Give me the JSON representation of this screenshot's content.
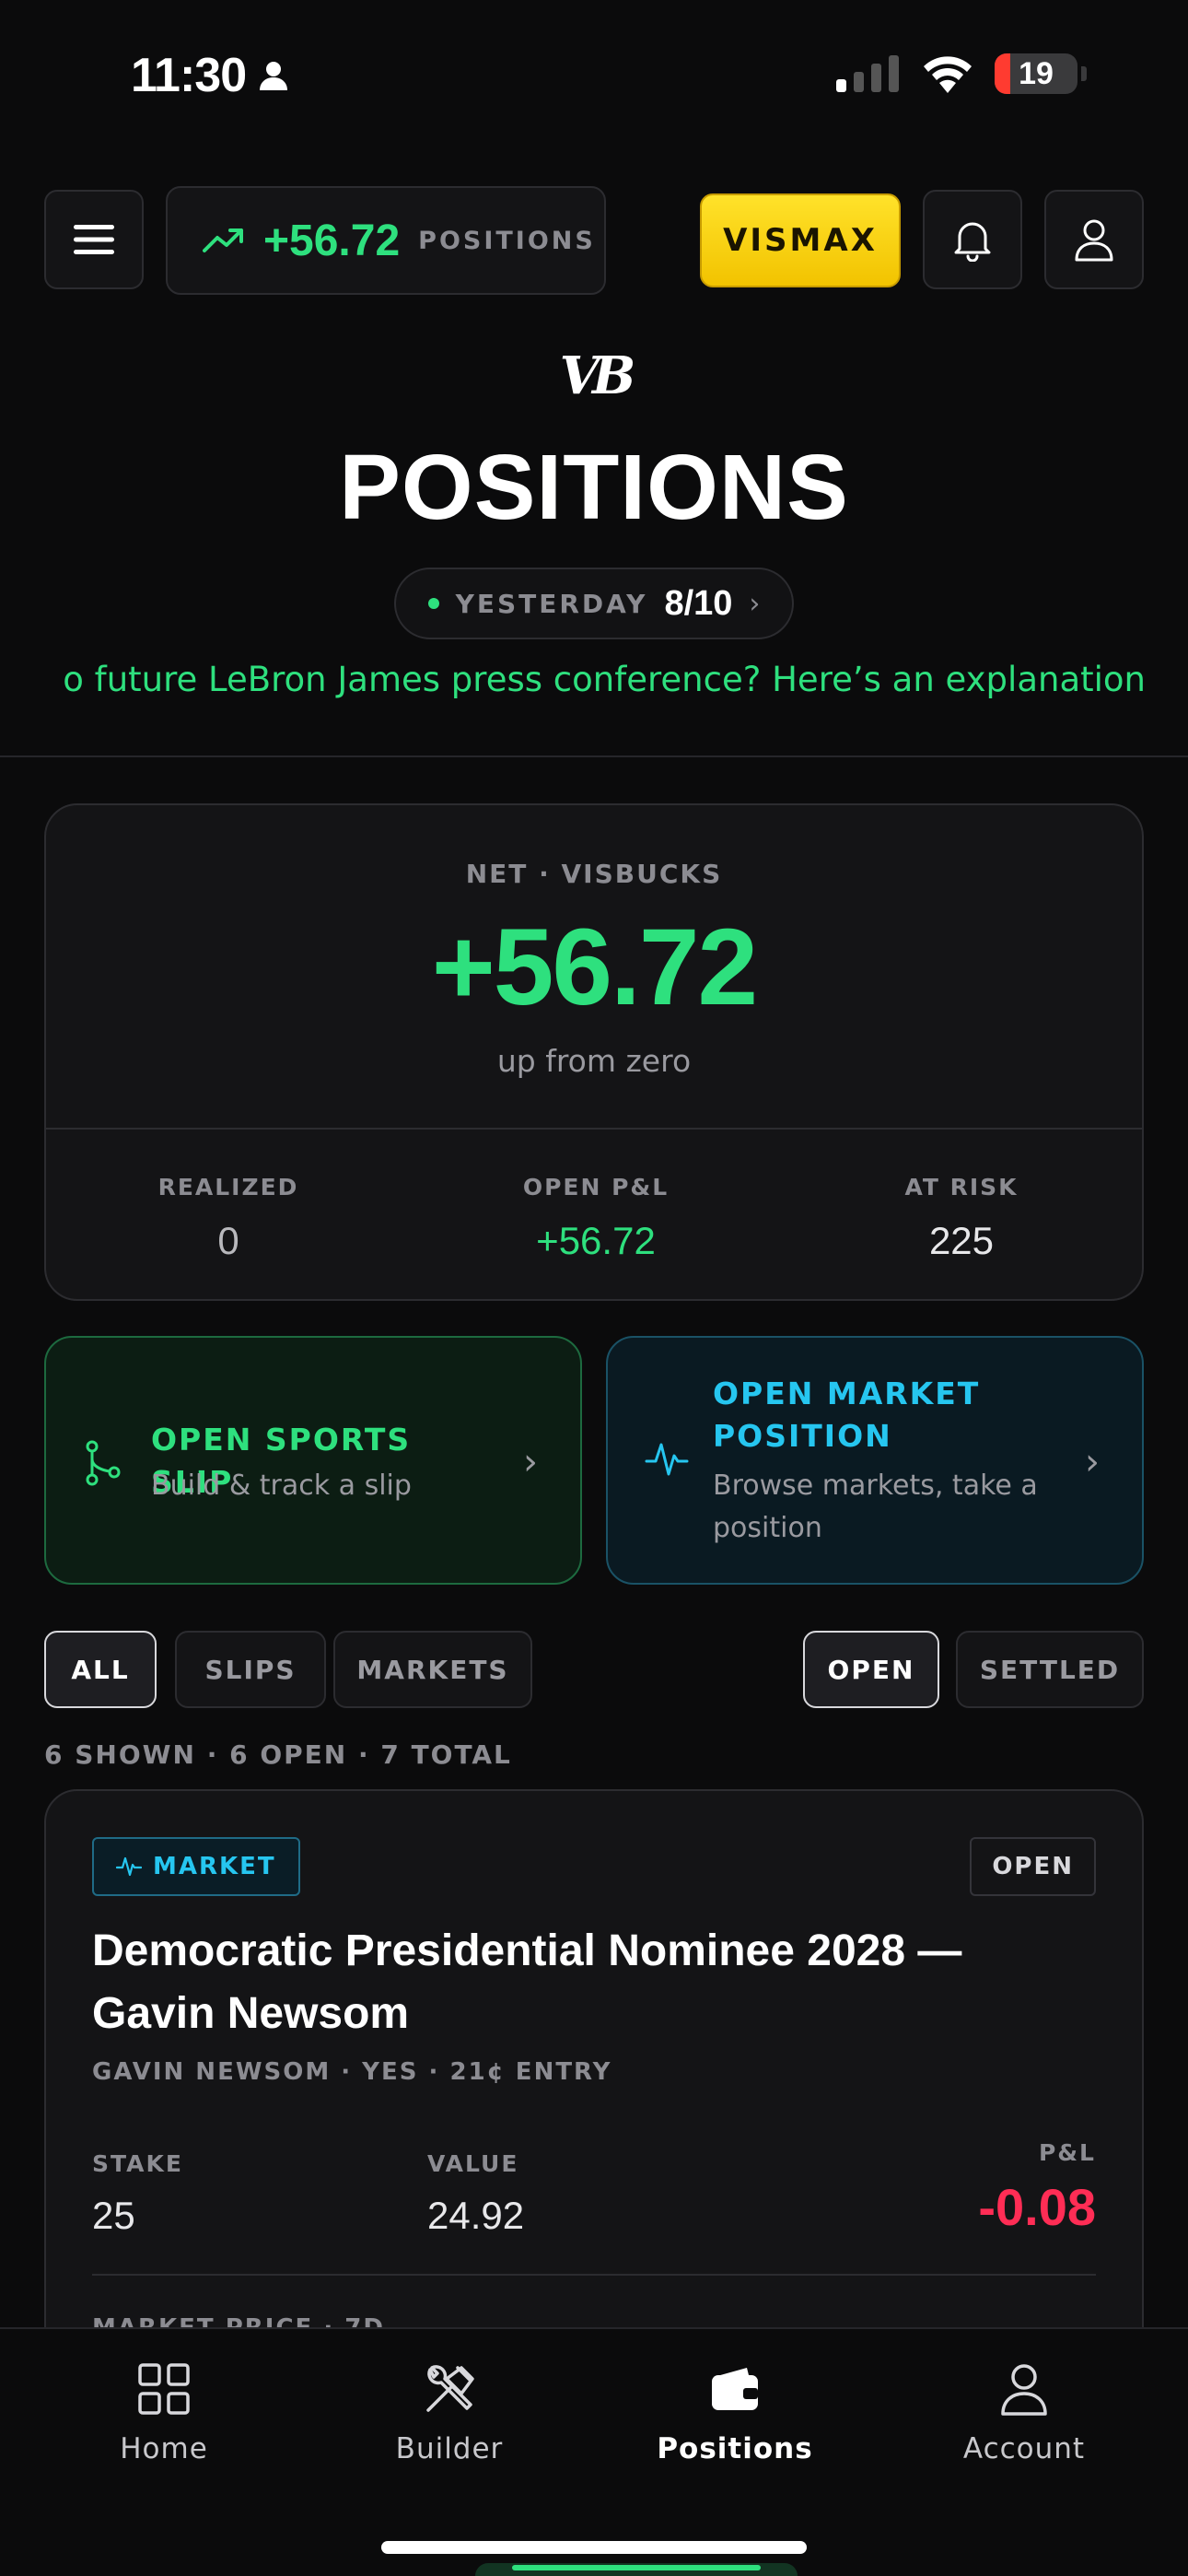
{
  "status_bar": {
    "time": "11:30",
    "battery": "19",
    "battery_level": 0.19
  },
  "header": {
    "positions_value": "+56.72",
    "positions_label": "POSITIONS",
    "vismax_label": "VISMAX",
    "logo_text": "VB",
    "page_title": "POSITIONS",
    "day_label": "YESTERDAY",
    "day_score": "8/10",
    "ticker": "o future LeBron James press conference? Here’s an explanation"
  },
  "net_card": {
    "label": "NET · VISBUCKS",
    "value": "+56.72",
    "subtitle": "up from zero",
    "stats": [
      {
        "label": "REALIZED",
        "value": "0"
      },
      {
        "label": "OPEN P&L",
        "value": "+56.72"
      },
      {
        "label": "AT RISK",
        "value": "225"
      }
    ]
  },
  "actions": {
    "sports": {
      "title": "OPEN SPORTS SLIP",
      "subtitle": "Build & track a slip"
    },
    "market": {
      "title": "OPEN MARKET POSITION",
      "subtitle": "Browse markets, take a position"
    }
  },
  "filters": {
    "type": [
      "ALL",
      "SLIPS",
      "MARKETS"
    ],
    "status": [
      "OPEN",
      "SETTLED"
    ],
    "summary": "6 SHOWN · 6 OPEN · 7 TOTAL"
  },
  "position": {
    "badge": "MARKET",
    "status": "OPEN",
    "title": "Democratic Presidential Nominee 2028 — Gavin Newsom",
    "meta": "GAVIN NEWSOM · YES · 21¢ ENTRY",
    "stake_label": "STAKE",
    "stake": "25",
    "value_label": "VALUE",
    "value": "24.92",
    "pnl_label": "P&L",
    "pnl": "-0.08",
    "next_line": "MARKET PRICE · 7D"
  },
  "nav": {
    "items": [
      {
        "label": "Home",
        "icon": "grid-icon"
      },
      {
        "label": "Builder",
        "icon": "tools-icon"
      },
      {
        "label": "Positions",
        "icon": "wallet-icon"
      },
      {
        "label": "Account",
        "icon": "person-icon"
      }
    ],
    "active": "Positions"
  },
  "colors": {
    "accent_green": "#2ee07e",
    "accent_cyan": "#26c6f0",
    "negative": "#ff2d55",
    "vismax_yellow": "#ffd60a"
  }
}
